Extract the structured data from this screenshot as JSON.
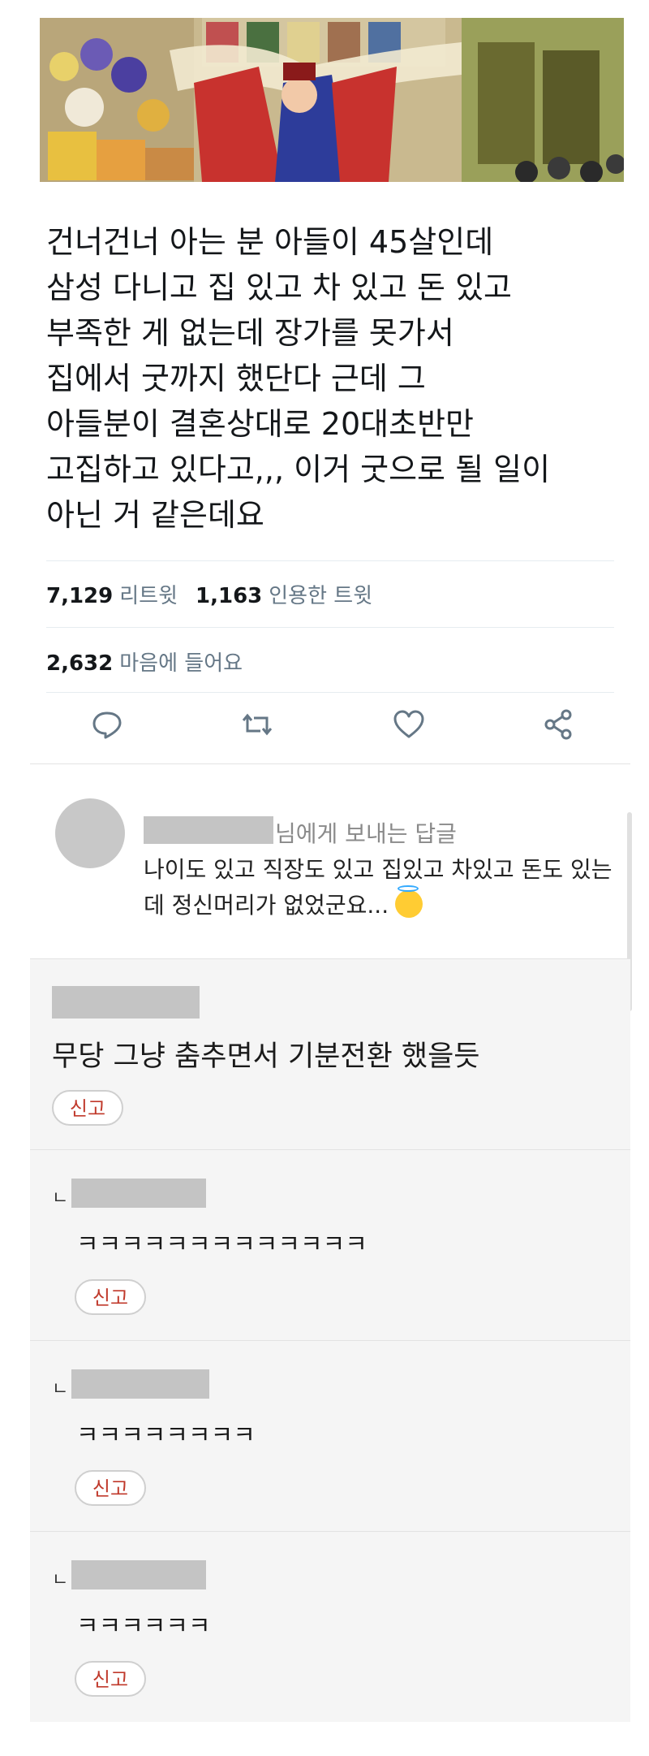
{
  "tweet": {
    "text": "건너건너 아는 분 아들이 45살인데\n삼성 다니고 집 있고 차 있고 돈 있고\n부족한 게 없는데 장가를 못가서\n집에서 굿까지 했단다 근데 그\n아들분이 결혼상대로 20대초반만\n고집하고 있다고,,, 이거 굿으로 될 일이\n아닌 거 같은데요",
    "retweets_count": "7,129",
    "retweets_label": "리트윗",
    "quotes_count": "1,163",
    "quotes_label": "인용한 트윗",
    "likes_count": "2,632",
    "likes_label": "마음에 들어요",
    "actions": [
      "reply-icon",
      "retweet-icon",
      "heart-icon",
      "share-icon"
    ]
  },
  "reply": {
    "reply_to_suffix": "님에게 보내는 답글",
    "text": "나이도 있고 직장도 있고 집있고 차있고 돈도 있는데 정신머리가 없었군요..."
  },
  "comments": [
    {
      "text": "무당 그냥 춤추면서 기분전환 했을듯",
      "report_label": "신고",
      "is_sub": false
    },
    {
      "marker": "ㄴ",
      "text": "ㅋㅋㅋㅋㅋㅋㅋㅋㅋㅋㅋㅋㅋ",
      "report_label": "신고",
      "is_sub": true
    },
    {
      "marker": "ㄴ",
      "text": "ㅋㅋㅋㅋㅋㅋㅋㅋ",
      "report_label": "신고",
      "is_sub": true
    },
    {
      "marker": "ㄴ",
      "text": "ㅋㅋㅋㅋㅋㅋ",
      "report_label": "신고",
      "is_sub": true
    }
  ],
  "colors": {
    "text": "#14171a",
    "muted": "#657786",
    "report_red": "#c0392b",
    "comment_bg": "#f5f5f5",
    "redacted": "#c4c4c4"
  }
}
